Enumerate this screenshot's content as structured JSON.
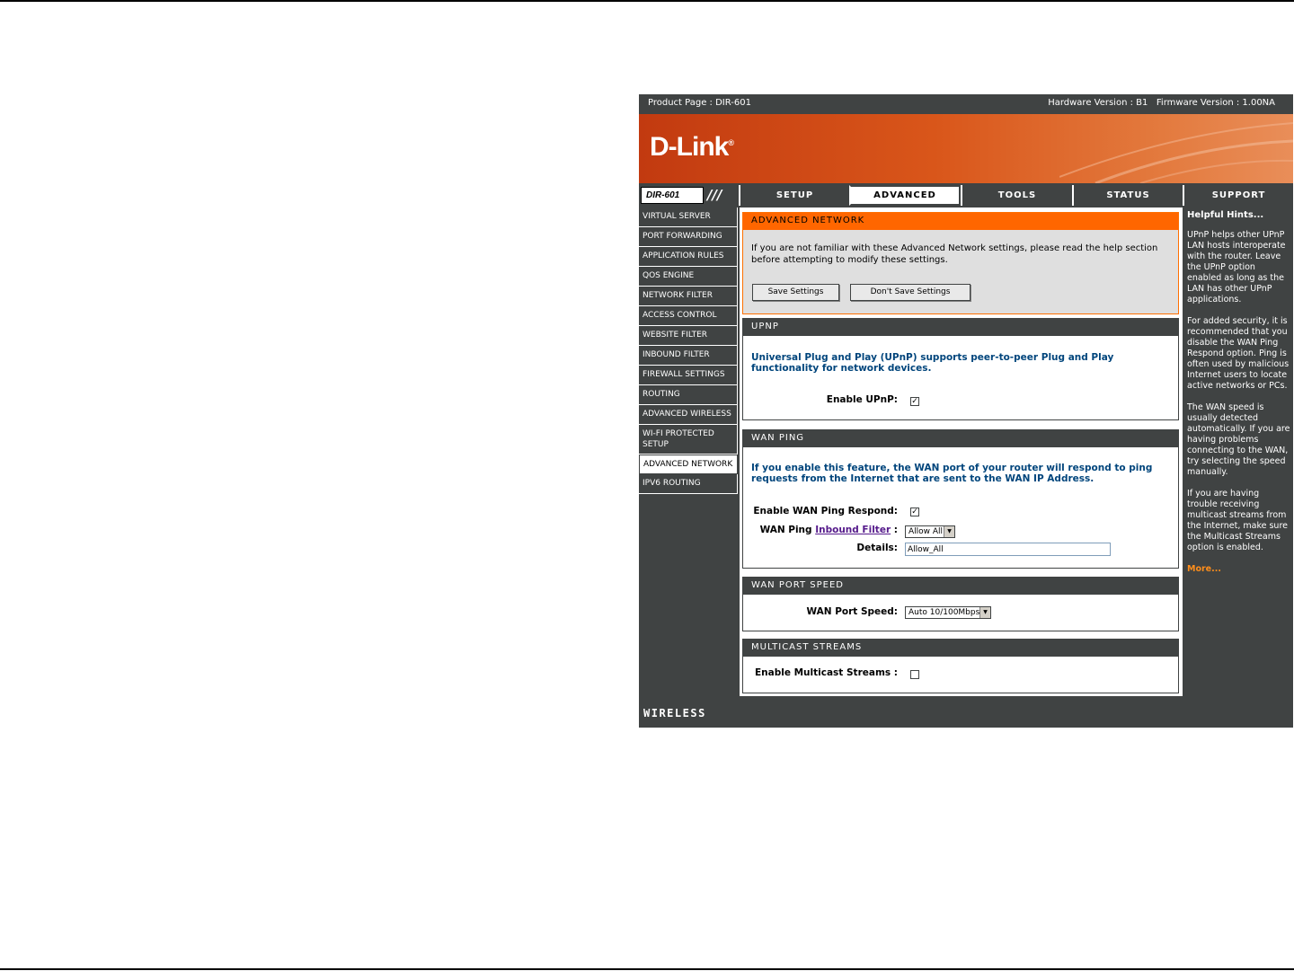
{
  "header": {
    "product_page": "Product Page : DIR-601",
    "versions": "Hardware Version : B1   Firmware Version : 1.00NA"
  },
  "brand": {
    "logo": "D-Link",
    "trademark": "®",
    "color": "#ff6600"
  },
  "model": {
    "name": "DIR-601"
  },
  "tabs": [
    {
      "label": "SETUP"
    },
    {
      "label": "ADVANCED"
    },
    {
      "label": "TOOLS"
    },
    {
      "label": "STATUS"
    },
    {
      "label": "SUPPORT"
    }
  ],
  "sidebar": {
    "items": [
      {
        "label": "VIRTUAL SERVER"
      },
      {
        "label": "PORT FORWARDING"
      },
      {
        "label": "APPLICATION RULES"
      },
      {
        "label": "QOS ENGINE"
      },
      {
        "label": "NETWORK FILTER"
      },
      {
        "label": "ACCESS CONTROL"
      },
      {
        "label": "WEBSITE FILTER"
      },
      {
        "label": "INBOUND FILTER"
      },
      {
        "label": "FIREWALL SETTINGS"
      },
      {
        "label": "ROUTING"
      },
      {
        "label": "ADVANCED WIRELESS"
      },
      {
        "label": "WI-FI PROTECTED SETUP"
      },
      {
        "label": "ADVANCED NETWORK"
      },
      {
        "label": "IPV6 ROUTING"
      }
    ]
  },
  "intro": {
    "title": "ADVANCED NETWORK",
    "text": "If you are not familiar with these Advanced Network settings, please read the help section before attempting to modify these settings.",
    "save_label": "Save Settings",
    "dont_save_label": "Don't Save Settings"
  },
  "upnp": {
    "title": "UPNP",
    "description": "Universal Plug and Play (UPnP) supports peer-to-peer Plug and Play functionality for network devices.",
    "enable_label": "Enable UPnP:",
    "enabled": "✓"
  },
  "wan_ping": {
    "title": "WAN PING",
    "description": "If you enable this feature, the WAN port of your router will respond to ping requests from the Internet that are sent to the WAN IP Address.",
    "enable_label": "Enable WAN Ping Respond:",
    "enabled": "✓",
    "filter_prefix": "WAN Ping",
    "filter_link": "Inbound Filter",
    "filter_suffix": ":",
    "filter_value": "Allow All",
    "details_label": "Details:",
    "details_value": "Allow_All"
  },
  "wan_port_speed": {
    "title": "WAN PORT SPEED",
    "label": "WAN Port Speed:",
    "value": "Auto 10/100Mbps"
  },
  "multicast": {
    "title": "MULTICAST STREAMS",
    "label": "Enable Multicast Streams :"
  },
  "hints": {
    "title": "Helpful Hints...",
    "paragraphs": [
      "UPnP helps other UPnP LAN hosts interoperate with the router. Leave the UPnP option enabled as long as the LAN has other UPnP applications.",
      "For added security, it is recommended that you disable the WAN Ping Respond option. Ping is often used by malicious Internet users to locate active networks or PCs.",
      "The WAN speed is usually detected automatically. If you are having problems connecting to the WAN, try selecting the speed manually.",
      "If you are having trouble receiving multicast streams from the Internet, make sure the Multicast Streams option is enabled."
    ],
    "more": "More..."
  },
  "footer": {
    "label": "WIRELESS"
  }
}
